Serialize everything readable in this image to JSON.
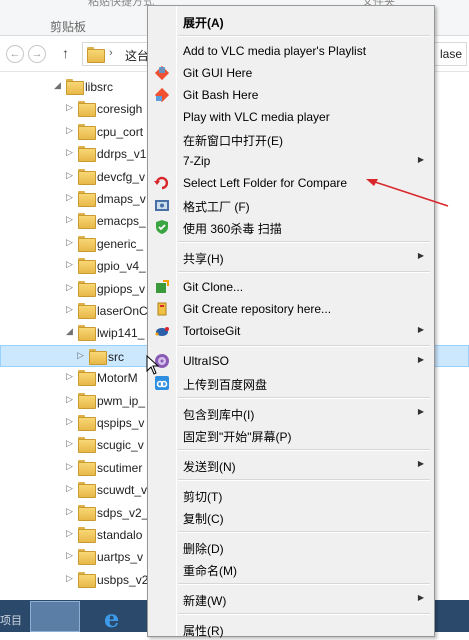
{
  "ribbon": {
    "clipboard_label": "剪贴板",
    "ghost_left": "粘贴快捷方式",
    "ghost_right": "文件夹"
  },
  "address": {
    "path_label": "这台",
    "path_right": "lase"
  },
  "tree": {
    "items": [
      {
        "label": "libsrc",
        "expanded": true,
        "level": 0
      },
      {
        "label": "coresigh",
        "level": 1
      },
      {
        "label": "cpu_cort",
        "level": 1
      },
      {
        "label": "ddrps_v1",
        "level": 1
      },
      {
        "label": "devcfg_v",
        "level": 1
      },
      {
        "label": "dmaps_v",
        "level": 1
      },
      {
        "label": "emacps_",
        "level": 1
      },
      {
        "label": "generic_",
        "level": 1
      },
      {
        "label": "gpio_v4_",
        "level": 1
      },
      {
        "label": "gpiops_v",
        "level": 1
      },
      {
        "label": "laserOnC",
        "level": 1
      },
      {
        "label": "lwip141_",
        "expanded": true,
        "level": 1
      },
      {
        "label": "src",
        "level": 2,
        "selected": true
      },
      {
        "label": "MotorM",
        "level": 1
      },
      {
        "label": "pwm_ip_",
        "level": 1
      },
      {
        "label": "qspips_v",
        "level": 1
      },
      {
        "label": "scugic_v",
        "level": 1
      },
      {
        "label": "scutimer",
        "level": 1
      },
      {
        "label": "scuwdt_v",
        "level": 1
      },
      {
        "label": "sdps_v2_",
        "level": 1
      },
      {
        "label": "standalo",
        "level": 1
      },
      {
        "label": "uartps_v",
        "level": 1
      },
      {
        "label": "usbps_v2",
        "level": 1
      }
    ]
  },
  "taskbar": {
    "left_label": "项目"
  },
  "menu": {
    "items": [
      {
        "type": "item",
        "label": "展开(A)",
        "bold": true,
        "icon": "none"
      },
      {
        "type": "sep"
      },
      {
        "type": "item",
        "label": "Add to VLC media player's Playlist",
        "icon": "none"
      },
      {
        "type": "item",
        "label": "Git GUI Here",
        "icon": "git-gui-icon"
      },
      {
        "type": "item",
        "label": "Git Bash Here",
        "icon": "git-bash-icon"
      },
      {
        "type": "item",
        "label": "Play with VLC media player",
        "icon": "none"
      },
      {
        "type": "item",
        "label": "在新窗口中打开(E)",
        "icon": "none"
      },
      {
        "type": "item",
        "label": "7-Zip",
        "icon": "none",
        "submenu": true
      },
      {
        "type": "item",
        "label": "Select Left Folder for Compare",
        "icon": "compare-icon"
      },
      {
        "type": "item",
        "label": "格式工厂 (F)",
        "icon": "format-factory-icon"
      },
      {
        "type": "item",
        "label": "使用 360杀毒 扫描",
        "icon": "shield-360-icon"
      },
      {
        "type": "sep"
      },
      {
        "type": "item",
        "label": "共享(H)",
        "icon": "none",
        "submenu": true
      },
      {
        "type": "sep"
      },
      {
        "type": "item",
        "label": "Git Clone...",
        "icon": "git-clone-icon"
      },
      {
        "type": "item",
        "label": "Git Create repository here...",
        "icon": "git-create-icon"
      },
      {
        "type": "item",
        "label": "TortoiseGit",
        "icon": "tortoisegit-icon",
        "submenu": true
      },
      {
        "type": "sep"
      },
      {
        "type": "item",
        "label": "UltraISO",
        "icon": "ultraiso-icon",
        "submenu": true
      },
      {
        "type": "item",
        "label": "上传到百度网盘",
        "icon": "baidu-cloud-icon"
      },
      {
        "type": "sep"
      },
      {
        "type": "item",
        "label": "包含到库中(I)",
        "icon": "none",
        "submenu": true
      },
      {
        "type": "item",
        "label": "固定到\"开始\"屏幕(P)",
        "icon": "none"
      },
      {
        "type": "sep"
      },
      {
        "type": "item",
        "label": "发送到(N)",
        "icon": "none",
        "submenu": true
      },
      {
        "type": "sep"
      },
      {
        "type": "item",
        "label": "剪切(T)",
        "icon": "none"
      },
      {
        "type": "item",
        "label": "复制(C)",
        "icon": "none"
      },
      {
        "type": "sep"
      },
      {
        "type": "item",
        "label": "删除(D)",
        "icon": "none"
      },
      {
        "type": "item",
        "label": "重命名(M)",
        "icon": "none"
      },
      {
        "type": "sep"
      },
      {
        "type": "item",
        "label": "新建(W)",
        "icon": "none",
        "submenu": true
      },
      {
        "type": "sep"
      },
      {
        "type": "item",
        "label": "属性(R)",
        "icon": "none"
      }
    ]
  },
  "colors": {
    "selection": "#cce8ff",
    "menu_bg": "#f0f0f0",
    "annotation_arrow": "#d9262b"
  }
}
